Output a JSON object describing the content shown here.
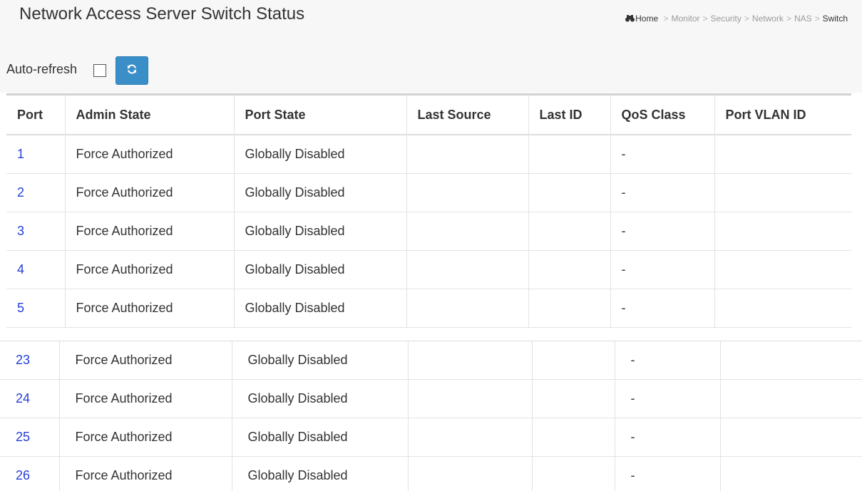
{
  "header": {
    "title": "Network Access Server Switch Status",
    "breadcrumb": [
      "Home",
      "Monitor",
      "Security",
      "Network",
      "NAS",
      "Switch"
    ]
  },
  "toolbar": {
    "auto_refresh_label": "Auto-refresh",
    "auto_refresh_checked": false
  },
  "table": {
    "columns": [
      "Port",
      "Admin State",
      "Port State",
      "Last Source",
      "Last ID",
      "QoS Class",
      "Port VLAN ID"
    ],
    "rows_top": [
      {
        "port": "1",
        "admin_state": "Force Authorized",
        "port_state": "Globally Disabled",
        "last_source": "",
        "last_id": "",
        "qos_class": "-",
        "port_vlan_id": ""
      },
      {
        "port": "2",
        "admin_state": "Force Authorized",
        "port_state": "Globally Disabled",
        "last_source": "",
        "last_id": "",
        "qos_class": "-",
        "port_vlan_id": ""
      },
      {
        "port": "3",
        "admin_state": "Force Authorized",
        "port_state": "Globally Disabled",
        "last_source": "",
        "last_id": "",
        "qos_class": "-",
        "port_vlan_id": ""
      },
      {
        "port": "4",
        "admin_state": "Force Authorized",
        "port_state": "Globally Disabled",
        "last_source": "",
        "last_id": "",
        "qos_class": "-",
        "port_vlan_id": ""
      },
      {
        "port": "5",
        "admin_state": "Force Authorized",
        "port_state": "Globally Disabled",
        "last_source": "",
        "last_id": "",
        "qos_class": "-",
        "port_vlan_id": ""
      }
    ],
    "rows_bottom": [
      {
        "port": "23",
        "admin_state": "Force Authorized",
        "port_state": "Globally Disabled",
        "last_source": "",
        "last_id": "",
        "qos_class": "-",
        "port_vlan_id": ""
      },
      {
        "port": "24",
        "admin_state": "Force Authorized",
        "port_state": "Globally Disabled",
        "last_source": "",
        "last_id": "",
        "qos_class": "-",
        "port_vlan_id": ""
      },
      {
        "port": "25",
        "admin_state": "Force Authorized",
        "port_state": "Globally Disabled",
        "last_source": "",
        "last_id": "",
        "qos_class": "-",
        "port_vlan_id": ""
      },
      {
        "port": "26",
        "admin_state": "Force Authorized",
        "port_state": "Globally Disabled",
        "last_source": "",
        "last_id": "",
        "qos_class": "-",
        "port_vlan_id": ""
      }
    ]
  },
  "icons": {
    "home": "home-icon",
    "refresh": "refresh-icon"
  },
  "colors": {
    "link": "#2440d6",
    "button": "#3a8fc9",
    "header_bg": "#f7f7f7"
  }
}
